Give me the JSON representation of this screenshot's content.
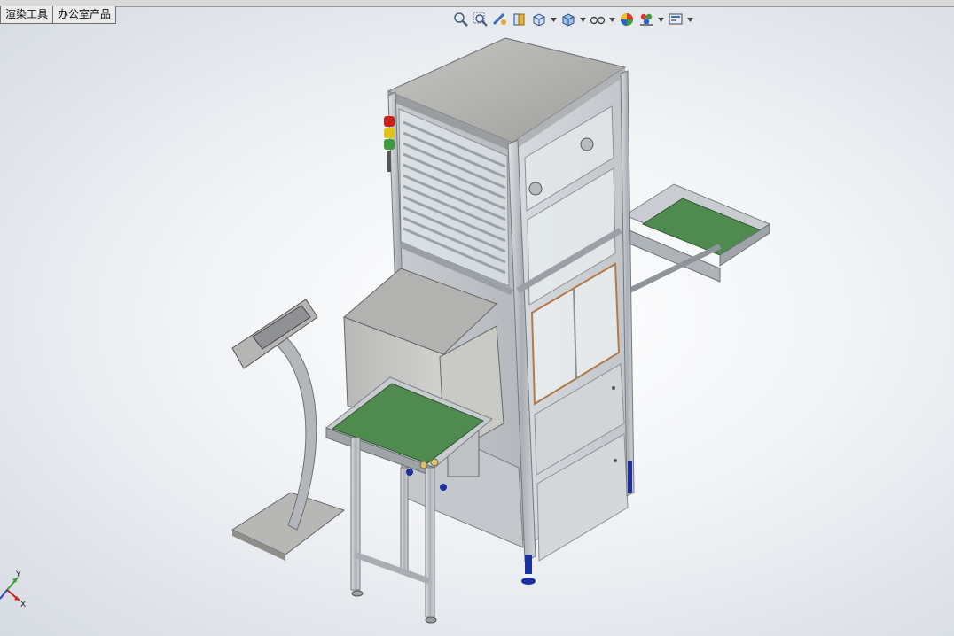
{
  "tabs": [
    {
      "label": "渲染工具"
    },
    {
      "label": "办公室产品"
    }
  ],
  "toolbar": {
    "icons": [
      "zoom-to-fit-icon",
      "zoom-to-area-icon",
      "previous-view-icon",
      "section-view-icon",
      "view-orientation-icon",
      "display-style-icon",
      "hide-show-items-icon",
      "edit-appearance-icon",
      "apply-scene-icon",
      "view-settings-icon"
    ]
  },
  "triad": {
    "x_label": "X",
    "y_label": "Y"
  },
  "colors": {
    "frame": "#b9bec4",
    "panel": "#aeb2b6",
    "belt": "#4f8a4f",
    "foot": "#1b2f9e"
  }
}
